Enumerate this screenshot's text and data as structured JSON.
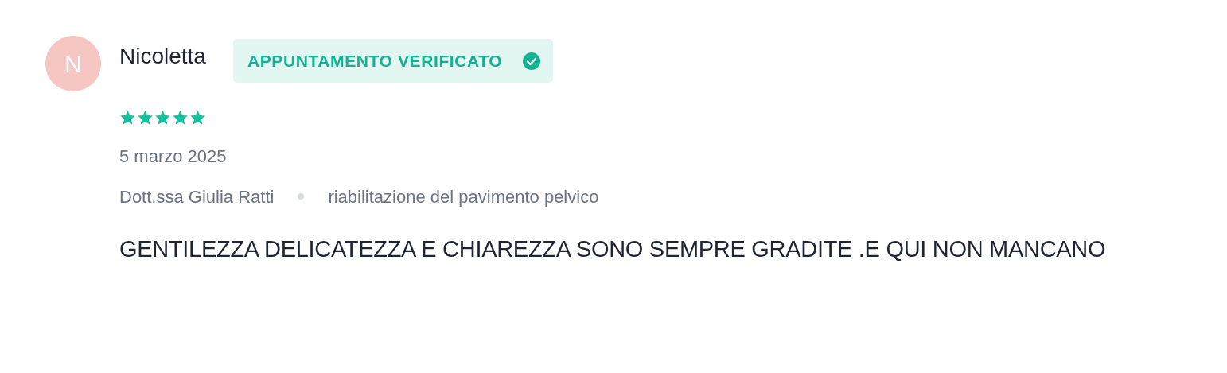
{
  "review": {
    "avatar_initial": "N",
    "author": "Nicoletta",
    "badge": {
      "label": "APPUNTAMENTO VERIFICATO",
      "verified": true
    },
    "stars": 5,
    "date": "5 marzo 2025",
    "doctor": "Dott.ssa Giulia Ratti",
    "service": "riabilitazione del pavimento pelvico",
    "text": "GENTILEZZA DELICATEZZA E CHIAREZZA SONO SEMPRE GRADITE .E QUI NON MANCANO"
  }
}
